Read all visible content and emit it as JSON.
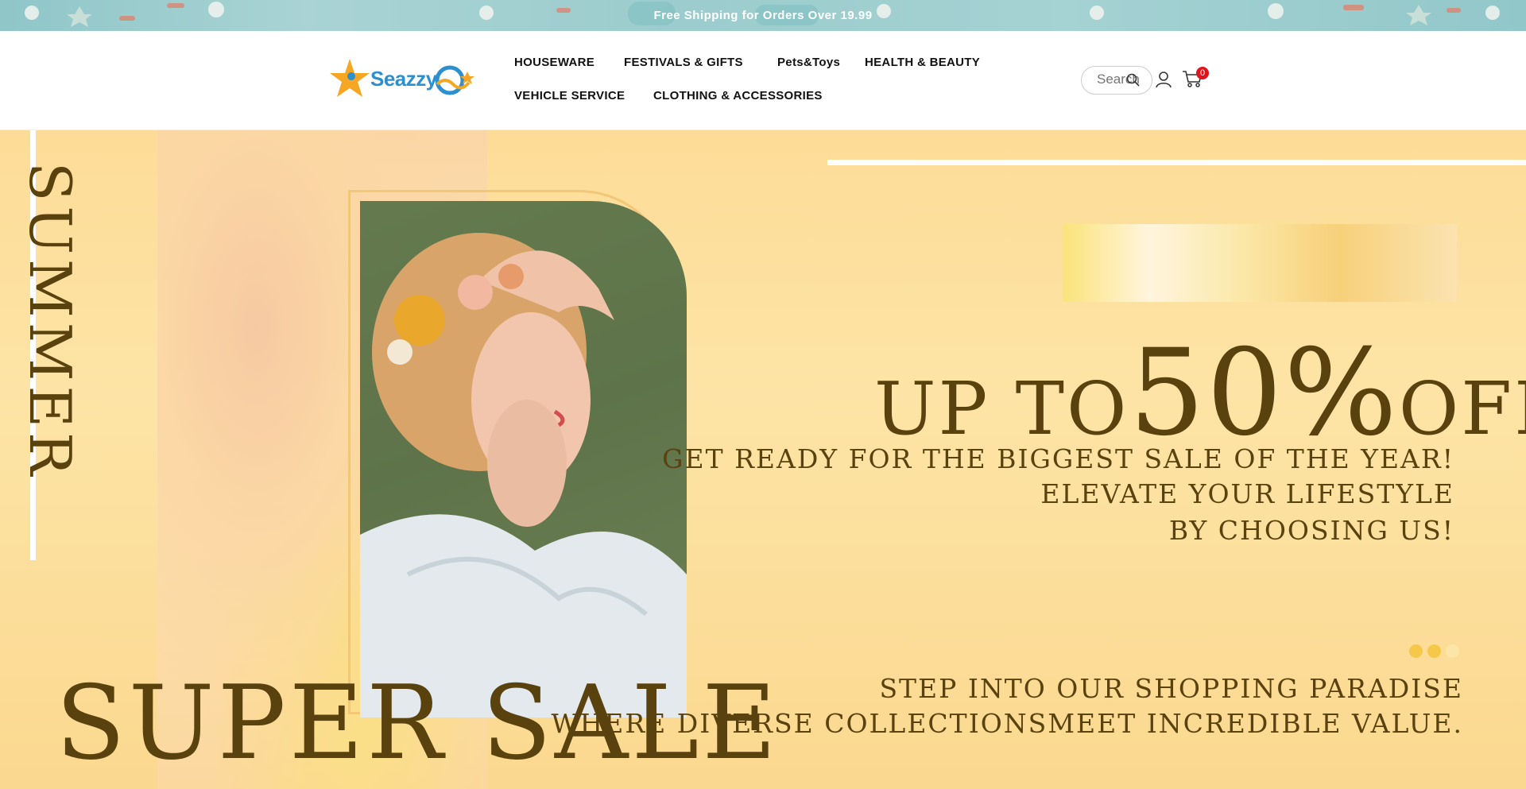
{
  "announcement": {
    "text": "Free Shipping for Orders Over   19.99"
  },
  "header": {
    "logo_text": "Seazzy",
    "nav": {
      "housewear": "HOUSEWARE",
      "festivals": "FESTIVALS & GIFTS",
      "pets": "Pets&Toys",
      "health": "HEALTH & BEAUTY",
      "vehicle": "VEHICLE SERVICE",
      "clothing": "CLOTHING & ACCESSORIES"
    },
    "search": {
      "placeholder": "Search"
    },
    "cart": {
      "count": "0"
    }
  },
  "icons": {
    "search": "search-icon",
    "user": "user-icon",
    "cart": "cart-icon"
  },
  "hero": {
    "vertical_word": "SUMMER",
    "big_word": "SUPER SALE",
    "headline_a": "UP TO",
    "headline_b": "50%",
    "headline_c": "OFF",
    "sub1": "GET READY FOR THE BIGGEST SALE OF THE YEAR!",
    "sub2": "ELEVATE YOUR LIFESTYLE",
    "sub3": "BY CHOOSING US!",
    "bottom1": "STEP INTO OUR SHOPPING PARADISE",
    "bottom2": "WHERE DIVERSE COLLECTIONSMEET INCREDIBLE VALUE.",
    "slides": 3,
    "active_slide": 1
  },
  "colors": {
    "accent": "#5a420f",
    "badge": "#e3131b",
    "hero_bg": "#fddc97",
    "announce_bg": "#a5d2d3"
  }
}
